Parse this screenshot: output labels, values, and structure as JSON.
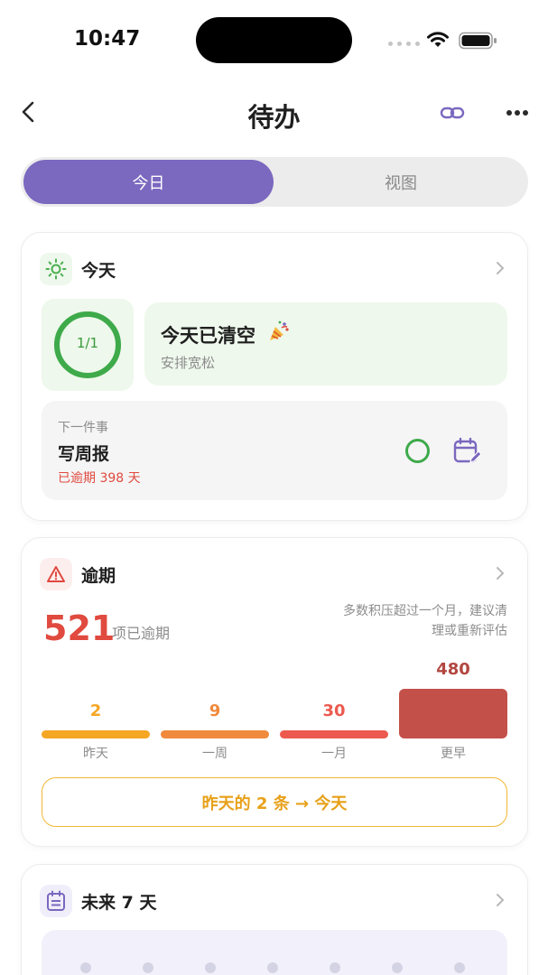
{
  "status_bar": {
    "time": "10:47"
  },
  "nav": {
    "title": "待办"
  },
  "segment": {
    "tabs": [
      "今日",
      "视图"
    ],
    "active": 0
  },
  "today_card": {
    "title": "今天",
    "progress_label": "1/1",
    "progress_fraction": 1.0,
    "cleared_title": "今天已清空",
    "cleared_sub": "安排宽松",
    "next_label": "下一件事",
    "next_task": "写周报",
    "next_overdue": "已逾期 398 天"
  },
  "overdue_card": {
    "title": "逾期",
    "count": "521",
    "count_label": "项已逾期",
    "advice": "多数积压超过一个月，建议清理或重新评估",
    "move_button": "昨天的 2 条 → 今天"
  },
  "chart_data": {
    "type": "bar",
    "categories": [
      "昨天",
      "一周",
      "一月",
      "更早"
    ],
    "values": [
      2,
      9,
      30,
      480
    ],
    "colors": [
      "#f5a623",
      "#f08a3c",
      "#ec5a4f",
      "#c4504a"
    ]
  },
  "week_card": {
    "title": "未来 7 天"
  },
  "colors": {
    "accent": "#7b68bf",
    "success": "#3eaa4a",
    "danger": "#e04a3f",
    "warning": "#e7a11a"
  }
}
